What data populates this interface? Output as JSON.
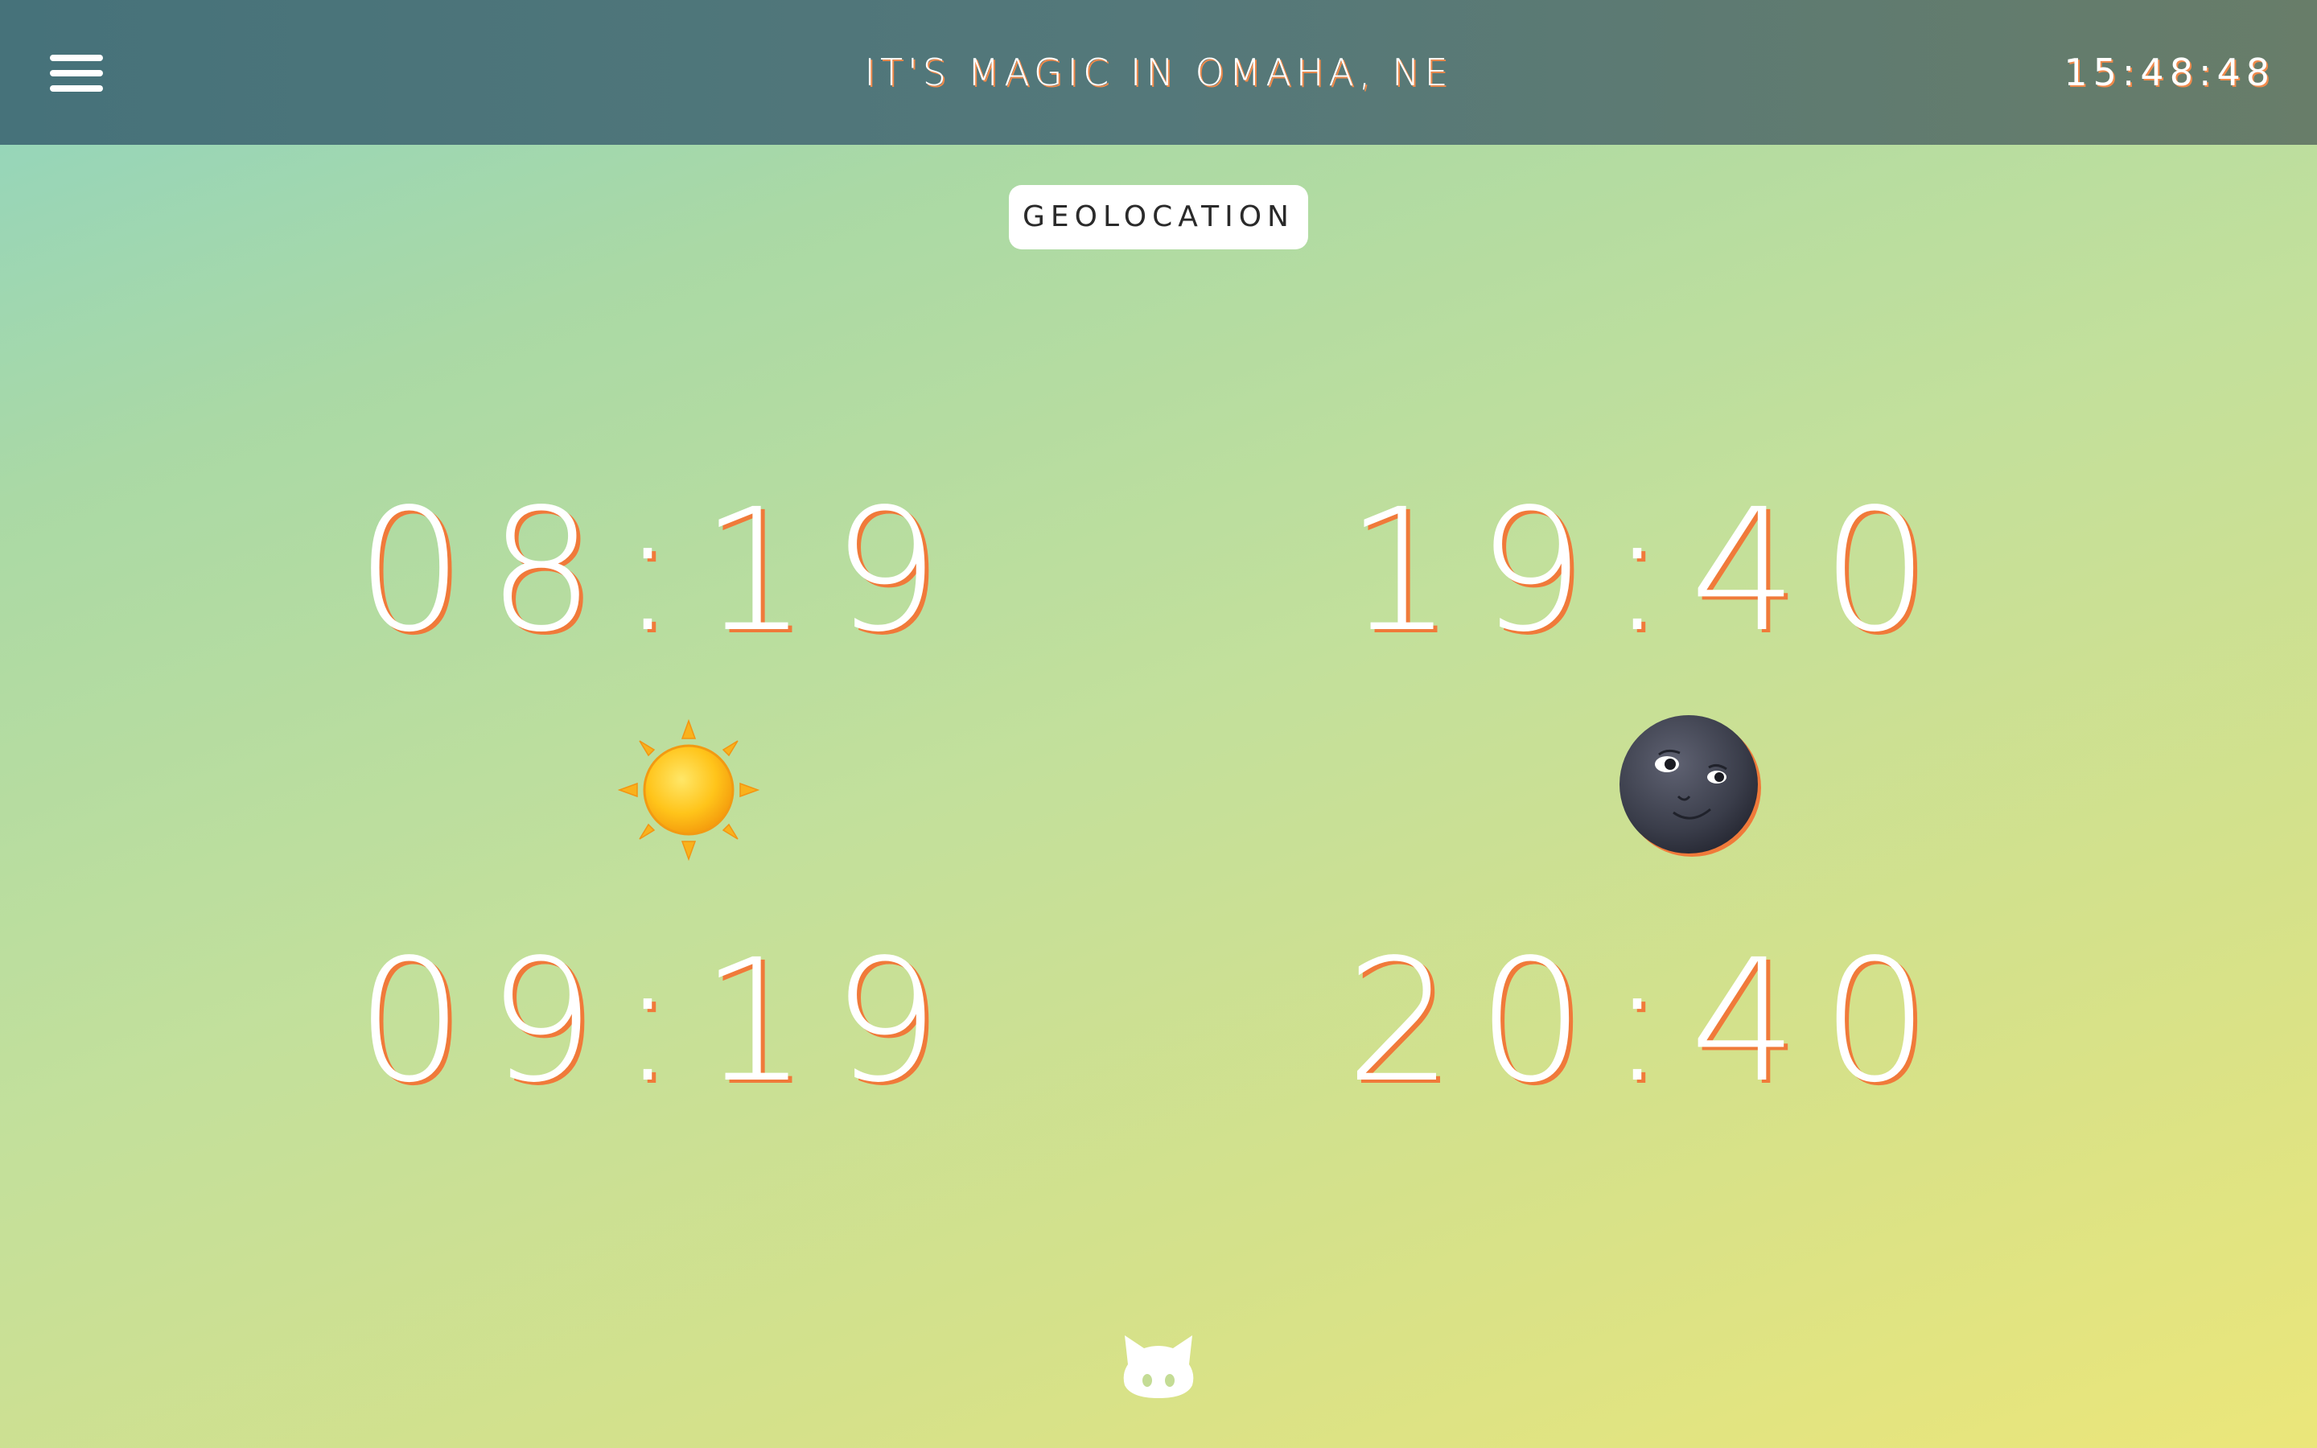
{
  "header": {
    "menu_icon": "hamburger-menu-icon",
    "title": "IT'S MAGIC IN OMAHA, NE",
    "clock": "15:48:48"
  },
  "geolocation_button": {
    "label": "GEOLOCATION"
  },
  "times": {
    "sunrise_primary": "08:19",
    "sunset_primary": "19:40",
    "sunrise_secondary": "09:19",
    "sunset_secondary": "20:40"
  },
  "icons": {
    "sun": "sun-icon",
    "moon": "new-moon-face-icon",
    "footer": "github-octocat-icon"
  },
  "colors": {
    "header_bg": "#54787a",
    "text": "#ffffff",
    "text_shadow": "#f07a3a",
    "gradient_start": "#8fd4c1",
    "gradient_end": "#ebe67a"
  }
}
